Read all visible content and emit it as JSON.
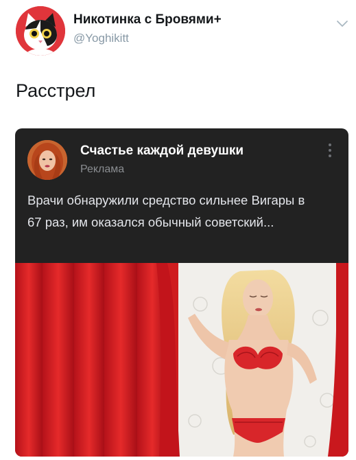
{
  "tweet": {
    "author": {
      "display_name": "Никотинка с Бровями+",
      "handle": "@Yoghikitt",
      "avatar_icon": "cat-avatar"
    },
    "text": "Расстрел",
    "menu_icon": "chevron-down-icon"
  },
  "embedded_post": {
    "source_name": "Счастье каждой девушки",
    "label": "Реклама",
    "body": "Врачи обнаружили средство сильнее Вигары в 67 раз, им оказался обычный советский...",
    "menu_icon": "more-vertical-icon",
    "colors": {
      "card_background": "#222222",
      "curtain_red": "#d01f1f"
    }
  }
}
